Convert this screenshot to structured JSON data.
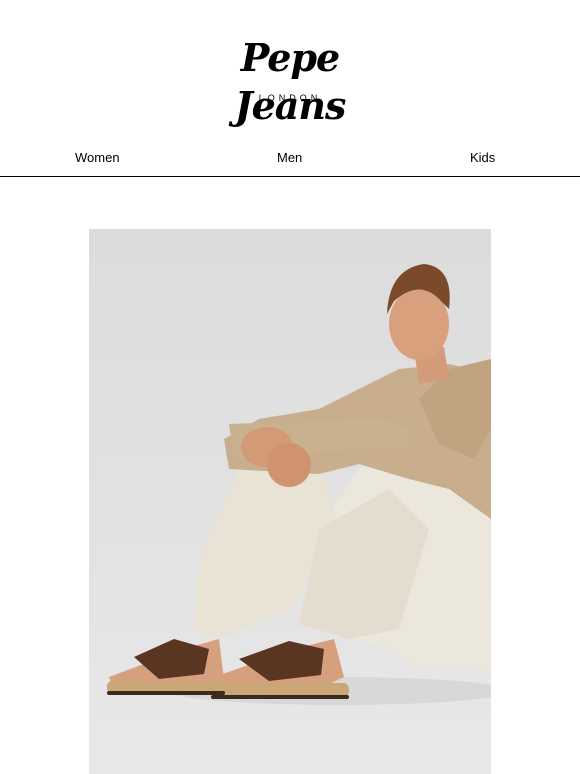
{
  "brand": {
    "name": "Pepe Jeans",
    "location": "LONDON"
  },
  "nav": {
    "items": [
      {
        "label": "Women"
      },
      {
        "label": "Men"
      },
      {
        "label": "Kids"
      }
    ]
  },
  "hero": {
    "background_color": "#dedede"
  }
}
